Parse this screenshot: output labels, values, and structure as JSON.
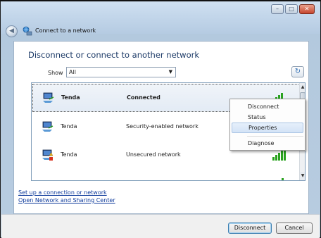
{
  "window": {
    "title": "Connect to a network",
    "caption_buttons": [
      "minimize",
      "maximize",
      "close"
    ]
  },
  "main": {
    "heading": "Disconnect or connect to another network",
    "show_label": "Show",
    "show_value": "All"
  },
  "networks": [
    {
      "name": "Tenda",
      "status": "Connected",
      "selected": true,
      "icon": "wireless-network-icon",
      "signal_bars": 4
    },
    {
      "name": "Tenda",
      "status": "Security-enabled network",
      "selected": false,
      "icon": "wireless-network-icon",
      "signal_bars": 4
    },
    {
      "name": "Tenda",
      "status": "Unsecured network",
      "selected": false,
      "icon": "unsecured-network-icon",
      "signal_bars": 5
    },
    {
      "name": "",
      "status": "",
      "selected": false,
      "icon": "wireless-network-icon",
      "signal_bars": 2
    }
  ],
  "context_menu": {
    "items": [
      "Disconnect",
      "Status",
      "Properties",
      "Diagnose"
    ],
    "highlighted": "Properties"
  },
  "links": {
    "setup": "Set up a connection or network",
    "sharing_center": "Open Network and Sharing Center"
  },
  "footer": {
    "disconnect_label": "Disconnect",
    "cancel_label": "Cancel"
  },
  "colors": {
    "signal_green": "#2aa21f",
    "heading_blue": "#1c3a67",
    "link_blue": "#0d3a9b"
  }
}
